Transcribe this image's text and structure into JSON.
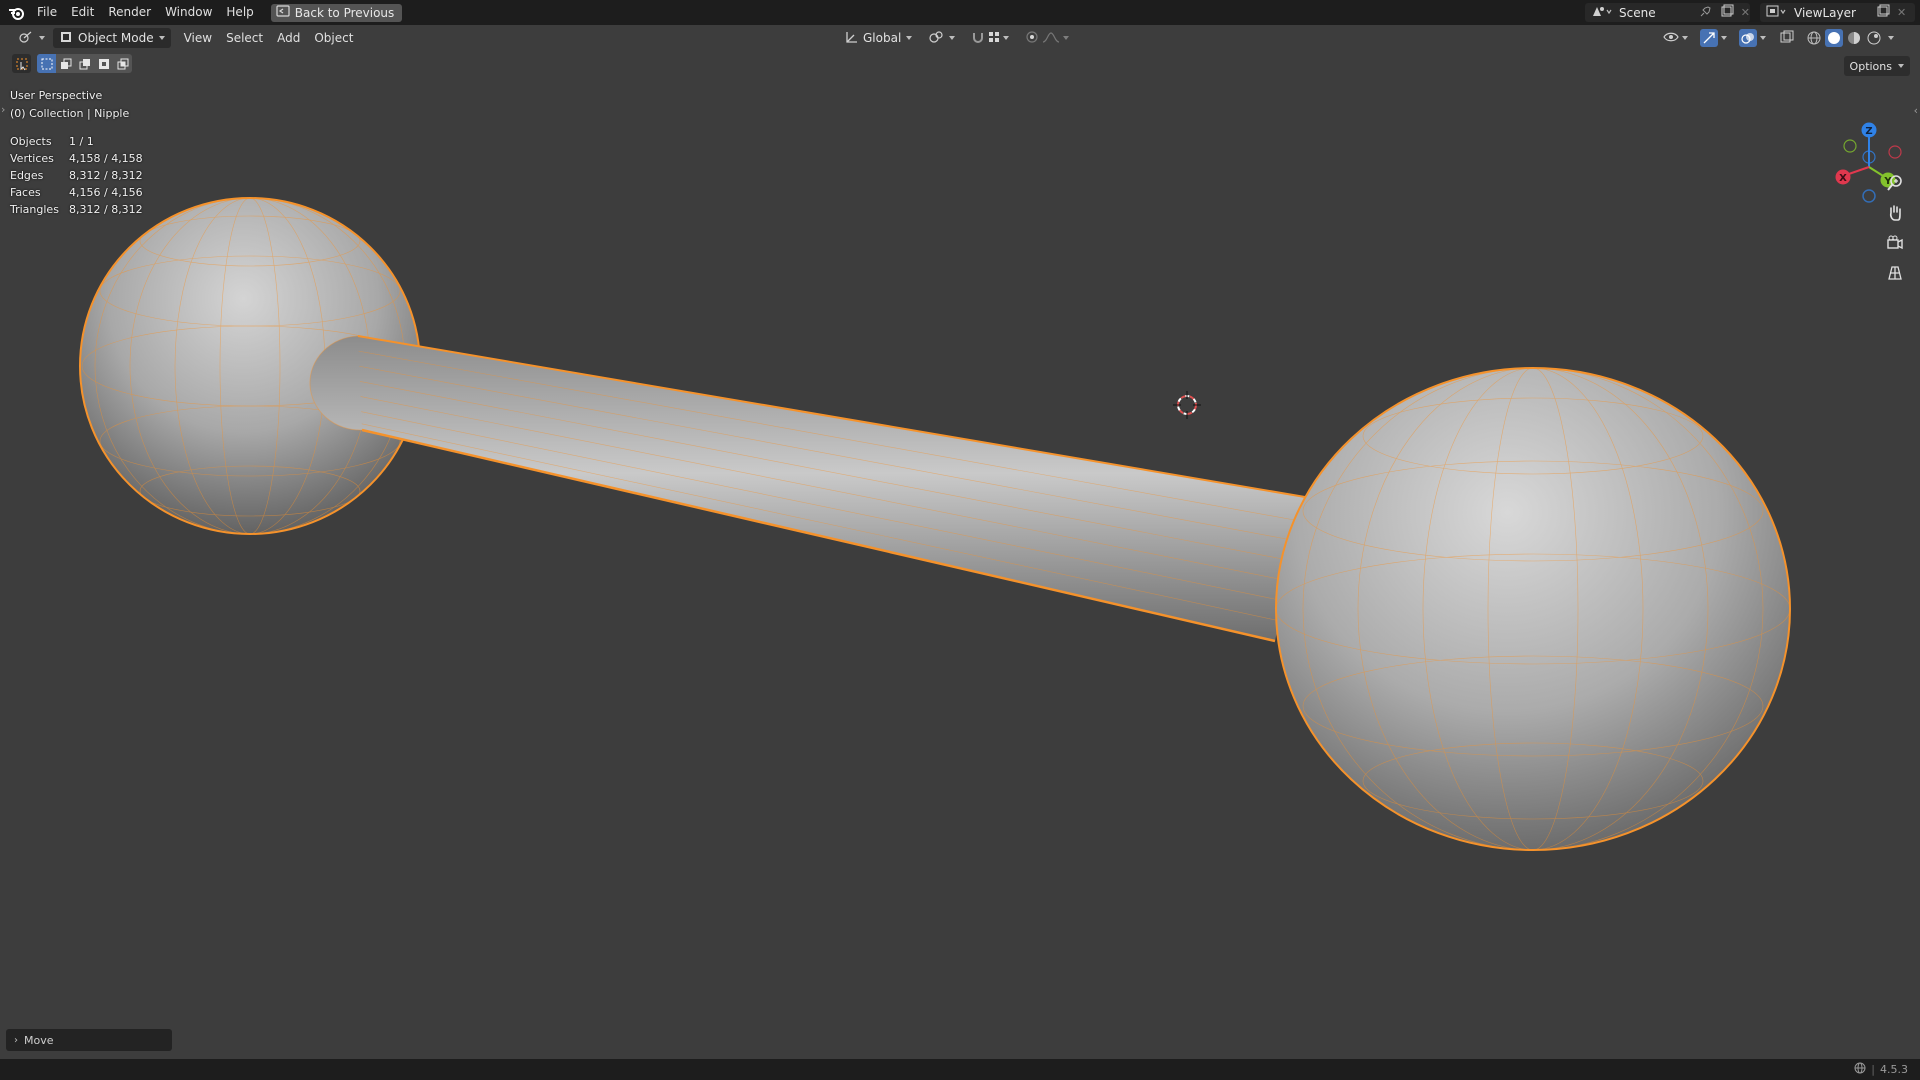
{
  "topbar": {
    "menus": [
      "File",
      "Edit",
      "Render",
      "Window",
      "Help"
    ],
    "back_button": "Back to Previous",
    "scene": "Scene",
    "view_layer": "ViewLayer"
  },
  "header": {
    "mode": "Object Mode",
    "menus": [
      "View",
      "Select",
      "Add",
      "Object"
    ],
    "orientation": "Global",
    "options": "Options"
  },
  "viewport": {
    "perspective": "User Perspective",
    "collection": "(0) Collection | Nipple",
    "stats": [
      {
        "label": "Objects",
        "value": "1 / 1"
      },
      {
        "label": "Vertices",
        "value": "4,158 / 4,158"
      },
      {
        "label": "Edges",
        "value": "8,312 / 8,312"
      },
      {
        "label": "Faces",
        "value": "4,156 / 4,156"
      },
      {
        "label": "Triangles",
        "value": "8,312 / 8,312"
      }
    ],
    "gizmo_labels": {
      "x": "X",
      "y": "Y",
      "z": "Z"
    }
  },
  "last_operator": "Move",
  "status": {
    "version": "4.5.3"
  },
  "colors": {
    "selection": "#f5922b",
    "active": "#4772b3",
    "axis_x": "#e0384e",
    "axis_y": "#83c22c",
    "axis_z": "#2f82e8"
  },
  "icons": [
    "blender-logo-icon",
    "back-icon",
    "editor-type-icon",
    "object-mode-icon",
    "orientation-icon",
    "pivot-icon",
    "snap-icon",
    "snap-increment-icon",
    "proportional-icon",
    "falloff-icon",
    "visibility-icon",
    "gizmo-icon",
    "overlay-icon",
    "xray-icon",
    "wireframe-shading-icon",
    "solid-shading-icon",
    "material-shading-icon",
    "rendered-shading-icon",
    "zoom-icon",
    "hand-icon",
    "camera-icon",
    "grid-icon",
    "cursor-icon"
  ]
}
